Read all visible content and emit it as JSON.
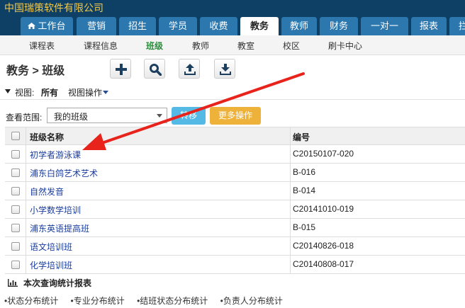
{
  "company": "中国瑞策软件有限公司",
  "main_tabs": [
    {
      "label": "工作台"
    },
    {
      "label": "营销"
    },
    {
      "label": "招生"
    },
    {
      "label": "学员"
    },
    {
      "label": "收费"
    },
    {
      "label": "教务"
    },
    {
      "label": "教师"
    },
    {
      "label": "财务"
    },
    {
      "label": "一对一"
    },
    {
      "label": "报表"
    },
    {
      "label": "拦"
    }
  ],
  "active_main_tab": "教务",
  "sub_nav": [
    {
      "label": "课程表"
    },
    {
      "label": "课程信息"
    },
    {
      "label": "班级"
    },
    {
      "label": "教师"
    },
    {
      "label": "教室"
    },
    {
      "label": "校区"
    },
    {
      "label": "刷卡中心"
    }
  ],
  "active_sub_nav": "班级",
  "breadcrumb": "教务 > 班级",
  "toolbar": {
    "add_icon": "plus-icon",
    "search_icon": "search-icon",
    "upload_icon": "upload-icon",
    "download_icon": "download-icon"
  },
  "view": {
    "label": "视图:",
    "current": "所有",
    "menu": "视图操作"
  },
  "scope": {
    "label": "查看范围:",
    "selected": "我的班级",
    "transfer_button": "转移",
    "more_button": "更多操作"
  },
  "table": {
    "headers": {
      "name": "班级名称",
      "code": "编号"
    },
    "rows": [
      {
        "name": "初学者游泳课",
        "code": "C20150107-020"
      },
      {
        "name": "浦东白鸽艺术艺术",
        "code": "B-016"
      },
      {
        "name": "自然发音",
        "code": "B-014"
      },
      {
        "name": "小学数学培训",
        "code": "C20141010-019"
      },
      {
        "name": "浦东英语提高班",
        "code": "B-015"
      },
      {
        "name": "语文培训班",
        "code": "C20140826-018"
      },
      {
        "name": "化学培训班",
        "code": "C20140808-017"
      }
    ]
  },
  "stats": {
    "title": "本次查询统计报表",
    "links": [
      "•状态分布统计",
      "•专业分布统计",
      "•结班状态分布统计",
      "•负责人分布统计"
    ]
  },
  "colors": {
    "header_bg": "#0e3f64",
    "tab_bg": "#2b77ae",
    "company_text": "#f2c94c",
    "active_sub": "#2e8b3e",
    "link": "#1a3c9e",
    "btn_blue": "#55b9e6",
    "btn_orange": "#eeb23a",
    "annotation_arrow": "#e8231b"
  }
}
